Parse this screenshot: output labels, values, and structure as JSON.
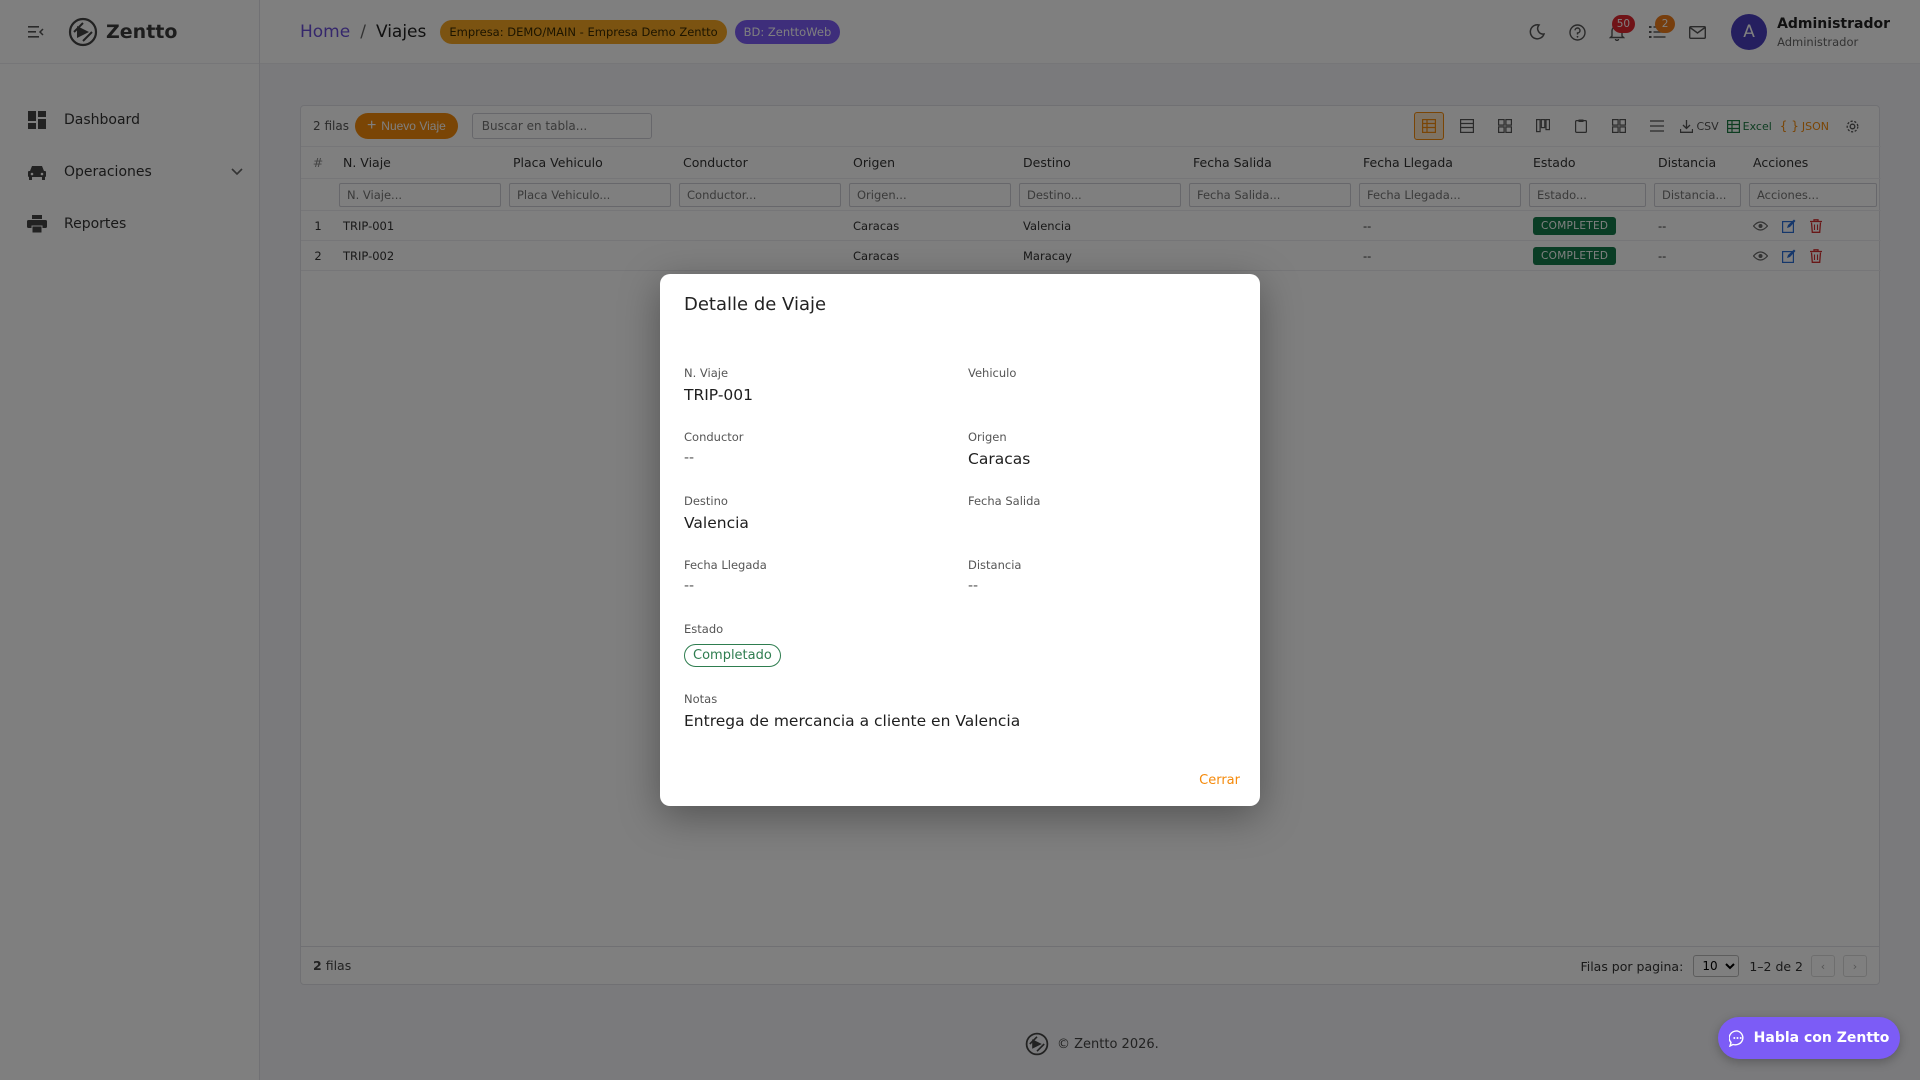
{
  "app": {
    "name": "Zentto"
  },
  "sidebar": {
    "items": [
      {
        "label": "Dashboard",
        "icon": "dashboard-icon"
      },
      {
        "label": "Operaciones",
        "icon": "car-icon",
        "expandable": true
      },
      {
        "label": "Reportes",
        "icon": "printer-icon"
      }
    ]
  },
  "header": {
    "breadcrumb": {
      "home": "Home",
      "sep": "/",
      "current": "Viajes"
    },
    "chips": {
      "empresa": "Empresa: DEMO/MAIN - Empresa Demo Zentto",
      "bd": "BD: ZenttoWeb"
    },
    "notifications_count": "50",
    "tasks_count": "2",
    "user": {
      "initial": "A",
      "name": "Administrador",
      "role": "Administrador"
    }
  },
  "toolbar": {
    "rows_label": "2 filas",
    "new_button": "Nuevo Viaje",
    "search_placeholder": "Buscar en tabla...",
    "csv_label": "CSV",
    "excel_label": "Excel",
    "json_label": "JSON"
  },
  "table": {
    "columns": [
      "#",
      "N. Viaje",
      "Placa Vehiculo",
      "Conductor",
      "Origen",
      "Destino",
      "Fecha Salida",
      "Fecha Llegada",
      "Estado",
      "Distancia",
      "Acciones"
    ],
    "filters": [
      "N. Viaje...",
      "Placa Vehiculo...",
      "Conductor...",
      "Origen...",
      "Destino...",
      "Fecha Salida...",
      "Fecha Llegada...",
      "Estado...",
      "Distancia...",
      "Acciones..."
    ],
    "rows": [
      {
        "idx": "1",
        "trip": "TRIP-001",
        "plate": "",
        "driver": "",
        "origin": "Caracas",
        "destination": "Valencia",
        "departure": "",
        "arrival": "--",
        "status": "COMPLETED",
        "distance": "--"
      },
      {
        "idx": "2",
        "trip": "TRIP-002",
        "plate": "",
        "driver": "",
        "origin": "Caracas",
        "destination": "Maracay",
        "departure": "",
        "arrival": "--",
        "status": "COMPLETED",
        "distance": "--"
      }
    ]
  },
  "footer": {
    "rows_bold": "2",
    "rows_text": "filas",
    "per_page_label": "Filas por pagina:",
    "per_page_value": "10",
    "range": "1–2 de 2",
    "prev": "‹",
    "next": "›"
  },
  "page_footer": {
    "copyright": "© Zentto 2026."
  },
  "chat": {
    "label": "Habla con Zentto"
  },
  "modal": {
    "title": "Detalle de Viaje",
    "fields": {
      "n_viaje": {
        "label": "N. Viaje",
        "value": "TRIP-001"
      },
      "vehiculo": {
        "label": "Vehiculo",
        "value": ""
      },
      "conductor": {
        "label": "Conductor",
        "value": "--"
      },
      "origen": {
        "label": "Origen",
        "value": "Caracas"
      },
      "destino": {
        "label": "Destino",
        "value": "Valencia"
      },
      "fecha_salida": {
        "label": "Fecha Salida",
        "value": ""
      },
      "fecha_llegada": {
        "label": "Fecha Llegada",
        "value": "--"
      },
      "distancia": {
        "label": "Distancia",
        "value": "--"
      },
      "estado": {
        "label": "Estado",
        "value": "Completado"
      },
      "notas": {
        "label": "Notas",
        "value": "Entrega de mercancia a cliente en Valencia"
      }
    },
    "close_button": "Cerrar"
  },
  "colors": {
    "accent": "#f58a0b",
    "brand_purple": "#7c5cf6",
    "status_green": "#147a4a",
    "badge_red": "#e0262f"
  }
}
